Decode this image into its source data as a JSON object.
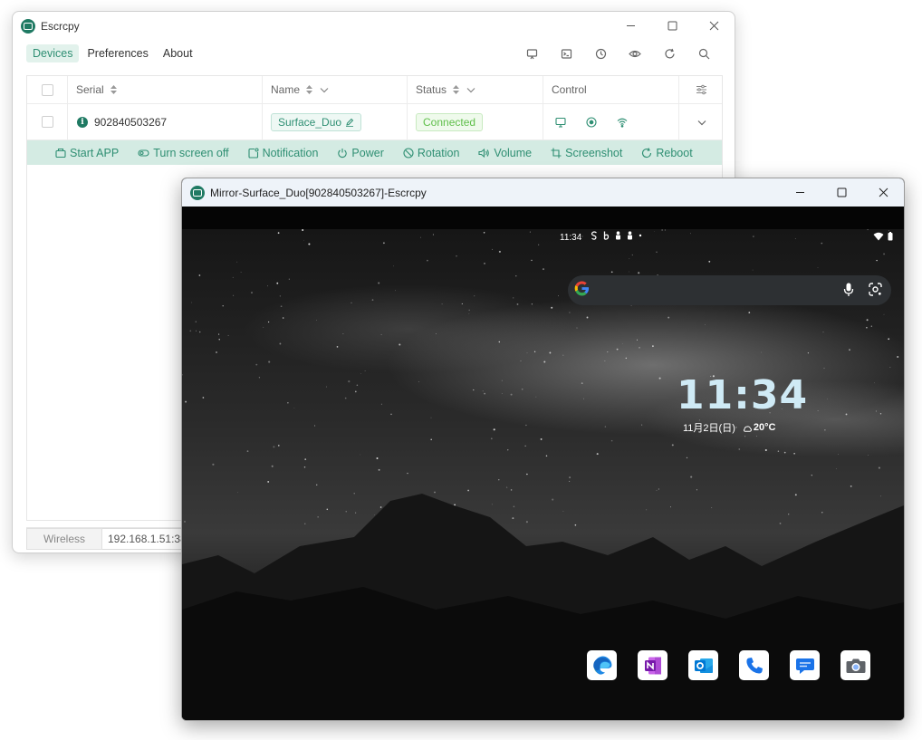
{
  "main_window": {
    "title": "Escrcpy",
    "menu": [
      {
        "label": "Devices",
        "active": true
      },
      {
        "label": "Preferences",
        "active": false
      },
      {
        "label": "About",
        "active": false
      }
    ],
    "toolbar_icons": [
      "cast-icon",
      "terminal-icon",
      "history-icon",
      "eye-icon",
      "refresh-icon",
      "search-icon"
    ],
    "table": {
      "headers": {
        "serial": "Serial",
        "name": "Name",
        "status": "Status",
        "control": "Control"
      },
      "row": {
        "serial": "902840503267",
        "name": "Surface_Duo",
        "status": "Connected"
      }
    },
    "actions": [
      {
        "label": "Start APP",
        "icon": "app-icon"
      },
      {
        "label": "Turn screen off",
        "icon": "toggle-icon"
      },
      {
        "label": "Notification",
        "icon": "notification-icon"
      },
      {
        "label": "Power",
        "icon": "power-icon"
      },
      {
        "label": "Rotation",
        "icon": "rotation-icon"
      },
      {
        "label": "Volume",
        "icon": "volume-icon"
      },
      {
        "label": "Screenshot",
        "icon": "crop-icon"
      },
      {
        "label": "Reboot",
        "icon": "reboot-icon"
      }
    ],
    "bottom": {
      "wireless_tab": "Wireless",
      "ip_value": "192.168.1.51:38"
    },
    "accent": "#2f8f73",
    "status_color": "#5fbf4a"
  },
  "mirror_window": {
    "title": "Mirror-Surface_Duo[902840503267]-Escrcpy",
    "device": {
      "status_time": "11:34",
      "clock": "11:34",
      "date": "11月2日(日)",
      "weather": "20°C",
      "dock_apps": [
        "edge-icon",
        "onenote-icon",
        "outlook-icon",
        "phone-icon",
        "messages-icon",
        "camera-icon"
      ]
    }
  }
}
